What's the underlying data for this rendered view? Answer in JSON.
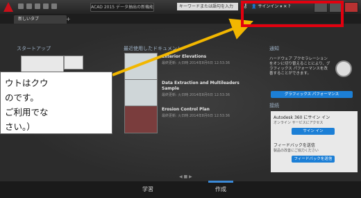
{
  "window": {
    "title_pill": "ACAD 2015 データ抽出の新機能",
    "search_placeholder": "キーワードまたは語句を入力",
    "signin_label": "サインイン",
    "key_icon": "key-icon"
  },
  "tabbar": {
    "tab_label": "新しいタブ",
    "plus": "+"
  },
  "start": {
    "title": "スタートアップ"
  },
  "recent": {
    "title": "最近使用したドキュメント",
    "items": [
      {
        "title": "Exterior Elevations",
        "sub": "最終更新: 火日時 2014年8月6日 12:53:36"
      },
      {
        "title": "Data Extraction and Multileaders",
        "title2": "Sample",
        "sub": "最終更新: 火日時 2014年8月6日 12:53:36"
      },
      {
        "title": "Erosion Control Plan",
        "sub": "最終更新: 火日時 2014年8月6日 12:53:36"
      }
    ],
    "pager": "◀ ■ ▶"
  },
  "notification": {
    "title": "通知",
    "text": "ハードウェア アクセラレーションをオンに切り替えることにより、グラフィックス パフォーマンスを改善することができます。",
    "button": "グラフィックス パフォーマンス"
  },
  "connect": {
    "title": "接続",
    "a360_title": "Autodesk 360 にサイン イン",
    "a360_sub": "オンライン サービスにアクセス",
    "signin_button": "サイン イン",
    "feedback_title": "フィードバックを送信",
    "feedback_sub": "製品の改善にご協力ください",
    "feedback_button": "フィードバックを送信"
  },
  "bottomnav": {
    "learn": "学習",
    "create": "作成"
  },
  "callout": {
    "line1": "ウトはクウ",
    "line2": "のです。",
    "line3": "ご利用でな",
    "line4": "さい。）"
  },
  "colors": {
    "highlight_box": "#e3000f",
    "arrow": "#f2b700",
    "accent": "#1c7fd6"
  }
}
